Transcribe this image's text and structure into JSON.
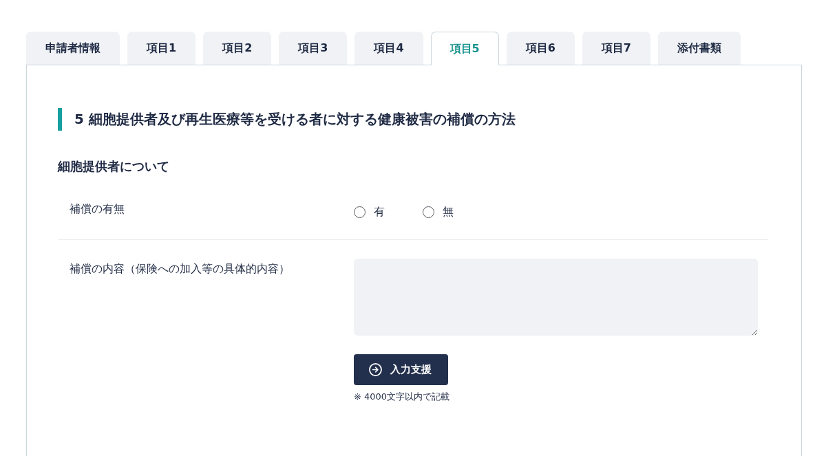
{
  "tabs": [
    {
      "label": "申請者情報",
      "selected": false
    },
    {
      "label": "項目1",
      "selected": false
    },
    {
      "label": "項目2",
      "selected": false
    },
    {
      "label": "項目3",
      "selected": false
    },
    {
      "label": "項目4",
      "selected": false
    },
    {
      "label": "項目5",
      "selected": true
    },
    {
      "label": "項目6",
      "selected": false
    },
    {
      "label": "項目7",
      "selected": false
    },
    {
      "label": "添付書類",
      "selected": false
    }
  ],
  "section": {
    "title": "5 細胞提供者及び再生医療等を受ける者に対する健康被害の補償の方法"
  },
  "subsection": {
    "title": "細胞提供者について"
  },
  "fields": [
    {
      "kind": "radio",
      "label": "補償の有無",
      "options": [
        {
          "label": "有",
          "selected": false
        },
        {
          "label": "無",
          "selected": false
        }
      ]
    },
    {
      "kind": "textarea",
      "label": "補償の内容（保険への加入等の具体的内容）",
      "button": "入力支援",
      "note": "※ 4000文字以内で記載"
    }
  ]
}
